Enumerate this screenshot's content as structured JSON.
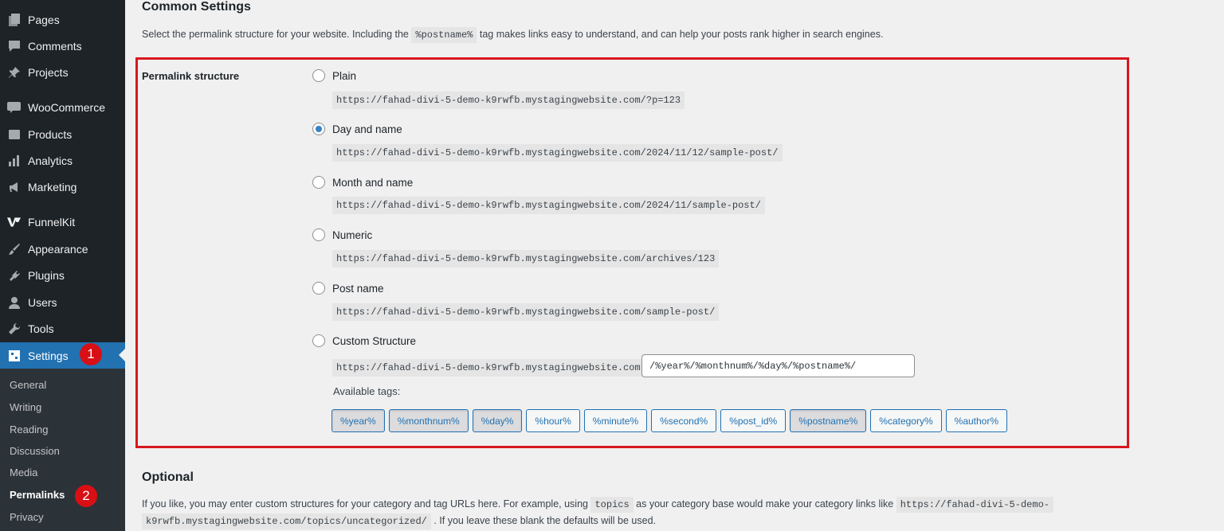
{
  "sidebar": {
    "items": [
      {
        "label": "Pages",
        "icon": "pages-icon"
      },
      {
        "label": "Comments",
        "icon": "comments-icon"
      },
      {
        "label": "Projects",
        "icon": "pin-icon"
      },
      {
        "label": "WooCommerce",
        "icon": "woocommerce-icon"
      },
      {
        "label": "Products",
        "icon": "products-icon"
      },
      {
        "label": "Analytics",
        "icon": "analytics-icon"
      },
      {
        "label": "Marketing",
        "icon": "megaphone-icon"
      },
      {
        "label": "FunnelKit",
        "icon": "funnelkit-icon"
      },
      {
        "label": "Appearance",
        "icon": "brush-icon"
      },
      {
        "label": "Plugins",
        "icon": "plugin-icon"
      },
      {
        "label": "Users",
        "icon": "users-icon"
      },
      {
        "label": "Tools",
        "icon": "wrench-icon"
      },
      {
        "label": "Settings",
        "icon": "settings-icon"
      }
    ],
    "submenu": [
      "General",
      "Writing",
      "Reading",
      "Discussion",
      "Media",
      "Permalinks",
      "Privacy"
    ],
    "badges": [
      "1",
      "2"
    ]
  },
  "common": {
    "title": "Common Settings",
    "desc_pre": "Select the permalink structure for your website. Including the",
    "desc_code": "%postname%",
    "desc_post": "tag makes links easy to understand, and can help your posts rank higher in search engines.",
    "field_label": "Permalink structure",
    "options": [
      {
        "label": "Plain",
        "url": "https://fahad-divi-5-demo-k9rwfb.mystagingwebsite.com/?p=123",
        "checked": false
      },
      {
        "label": "Day and name",
        "url": "https://fahad-divi-5-demo-k9rwfb.mystagingwebsite.com/2024/11/12/sample-post/",
        "checked": true
      },
      {
        "label": "Month and name",
        "url": "https://fahad-divi-5-demo-k9rwfb.mystagingwebsite.com/2024/11/sample-post/",
        "checked": false
      },
      {
        "label": "Numeric",
        "url": "https://fahad-divi-5-demo-k9rwfb.mystagingwebsite.com/archives/123",
        "checked": false
      },
      {
        "label": "Post name",
        "url": "https://fahad-divi-5-demo-k9rwfb.mystagingwebsite.com/sample-post/",
        "checked": false
      }
    ],
    "custom": {
      "label": "Custom Structure",
      "base": "https://fahad-divi-5-demo-k9rwfb.mystagingwebsite.com",
      "value": "/%year%/%monthnum%/%day%/%postname%/"
    },
    "available_tags_label": "Available tags:",
    "tags": [
      {
        "label": "%year%",
        "active": true
      },
      {
        "label": "%monthnum%",
        "active": true
      },
      {
        "label": "%day%",
        "active": true
      },
      {
        "label": "%hour%",
        "active": false
      },
      {
        "label": "%minute%",
        "active": false
      },
      {
        "label": "%second%",
        "active": false
      },
      {
        "label": "%post_id%",
        "active": false
      },
      {
        "label": "%postname%",
        "active": true
      },
      {
        "label": "%category%",
        "active": false
      },
      {
        "label": "%author%",
        "active": false
      }
    ]
  },
  "optional": {
    "title": "Optional",
    "line1_pre": "If you like, you may enter custom structures for your category and tag URLs here. For example, using",
    "line1_code": "topics",
    "line1_mid": "as your category base would make your category links like",
    "line1_code2": "https://fahad-divi-5-demo-",
    "line2_code": "k9rwfb.mystagingwebsite.com/topics/uncategorized/",
    "line2_post": ". If you leave these blank the defaults will be used."
  },
  "colors": {
    "accent": "#2271b1",
    "highlight": "#d8171d",
    "sidebar": "#1d2327"
  }
}
